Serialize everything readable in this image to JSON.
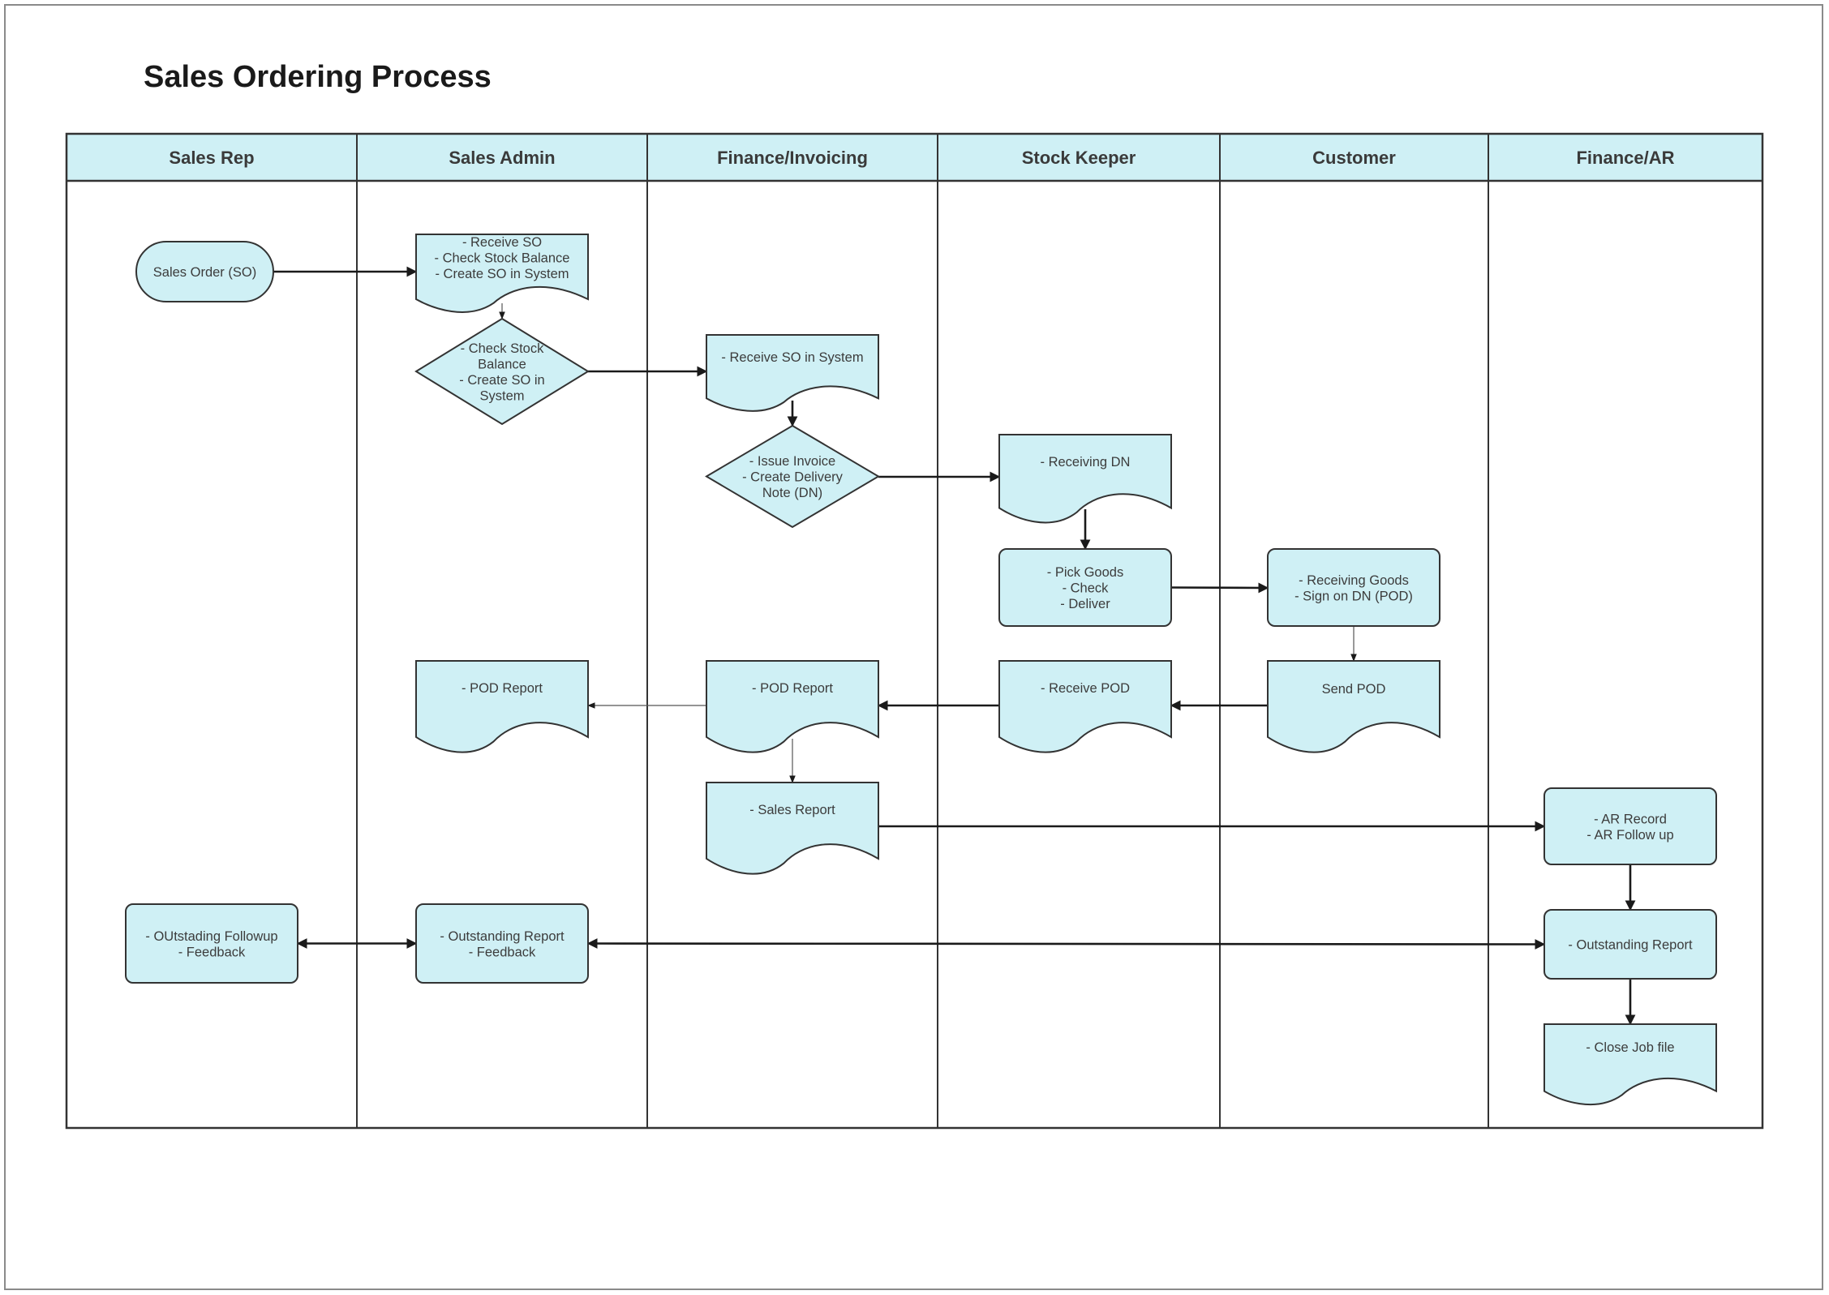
{
  "title": "Sales Ordering Process",
  "colors": {
    "shape_fill": "#cff0f5",
    "header_fill": "#cff0f5",
    "stroke": "#333333",
    "connector": "#1a1a1a"
  },
  "lanes": [
    {
      "id": "sales-rep",
      "label": "Sales Rep"
    },
    {
      "id": "sales-admin",
      "label": "Sales Admin"
    },
    {
      "id": "finance-invoicing",
      "label": "Finance/Invoicing"
    },
    {
      "id": "stock-keeper",
      "label": "Stock Keeper"
    },
    {
      "id": "customer",
      "label": "Customer"
    },
    {
      "id": "finance-ar",
      "label": "Finance/AR"
    }
  ],
  "nodes": [
    {
      "id": "n1",
      "lane": "sales-rep",
      "shape": "terminal",
      "lines": [
        "Sales Order (SO)"
      ]
    },
    {
      "id": "n2",
      "lane": "sales-admin",
      "shape": "document",
      "lines": [
        "- Receive SO",
        "- Check Stock Balance",
        "- Create SO in System"
      ]
    },
    {
      "id": "n3",
      "lane": "sales-admin",
      "shape": "decision",
      "lines": [
        "- Check Stock",
        "Balance",
        "- Create SO in",
        "System"
      ]
    },
    {
      "id": "n4",
      "lane": "finance-invoicing",
      "shape": "document",
      "lines": [
        "- Receive SO in System"
      ]
    },
    {
      "id": "n5",
      "lane": "finance-invoicing",
      "shape": "decision",
      "lines": [
        "- Issue Invoice",
        "- Create Delivery",
        "Note (DN)"
      ]
    },
    {
      "id": "n6",
      "lane": "stock-keeper",
      "shape": "document",
      "lines": [
        "- Receiving DN"
      ]
    },
    {
      "id": "n7",
      "lane": "stock-keeper",
      "shape": "process",
      "lines": [
        "- Pick Goods",
        "- Check",
        "- Deliver"
      ]
    },
    {
      "id": "n8",
      "lane": "customer",
      "shape": "process",
      "lines": [
        "- Receiving Goods",
        "- Sign on DN (POD)"
      ]
    },
    {
      "id": "n9",
      "lane": "customer",
      "shape": "document",
      "lines": [
        "Send POD"
      ]
    },
    {
      "id": "n10",
      "lane": "stock-keeper",
      "shape": "document",
      "lines": [
        "- Receive POD"
      ]
    },
    {
      "id": "n11",
      "lane": "finance-invoicing",
      "shape": "document",
      "lines": [
        "- POD Report"
      ]
    },
    {
      "id": "n12",
      "lane": "sales-admin",
      "shape": "document",
      "lines": [
        "- POD Report"
      ]
    },
    {
      "id": "n13",
      "lane": "finance-invoicing",
      "shape": "document",
      "lines": [
        "- Sales Report"
      ]
    },
    {
      "id": "n14",
      "lane": "finance-ar",
      "shape": "process",
      "lines": [
        "- AR Record",
        "- AR Follow up"
      ]
    },
    {
      "id": "n15",
      "lane": "finance-ar",
      "shape": "process",
      "lines": [
        "- Outstanding Report"
      ]
    },
    {
      "id": "n16",
      "lane": "finance-ar",
      "shape": "document",
      "lines": [
        "- Close Job file"
      ]
    },
    {
      "id": "n17",
      "lane": "sales-rep",
      "shape": "process",
      "lines": [
        "- OUtstading Followup",
        "- Feedback"
      ]
    },
    {
      "id": "n18",
      "lane": "sales-admin",
      "shape": "process",
      "lines": [
        "- Outstanding Report",
        "- Feedback"
      ]
    }
  ],
  "edges": [
    {
      "from": "n1",
      "to": "n2",
      "style": "bold"
    },
    {
      "from": "n2",
      "to": "n3",
      "style": "thin"
    },
    {
      "from": "n3",
      "to": "n4",
      "style": "bold"
    },
    {
      "from": "n4",
      "to": "n5",
      "style": "bold"
    },
    {
      "from": "n5",
      "to": "n6",
      "style": "bold"
    },
    {
      "from": "n6",
      "to": "n7",
      "style": "bold"
    },
    {
      "from": "n7",
      "to": "n8",
      "style": "bold"
    },
    {
      "from": "n8",
      "to": "n9",
      "style": "thin"
    },
    {
      "from": "n9",
      "to": "n10",
      "style": "bold"
    },
    {
      "from": "n10",
      "to": "n11",
      "style": "bold"
    },
    {
      "from": "n11",
      "to": "n12",
      "style": "thin"
    },
    {
      "from": "n11",
      "to": "n13",
      "style": "thin"
    },
    {
      "from": "n13",
      "to": "n14",
      "style": "bold"
    },
    {
      "from": "n14",
      "to": "n15",
      "style": "bold"
    },
    {
      "from": "n15",
      "to": "n16",
      "style": "bold"
    },
    {
      "from": "n17",
      "to": "n18",
      "style": "bold",
      "bidirectional": true
    },
    {
      "from": "n18",
      "to": "n15",
      "style": "bold",
      "bidirectional": true
    }
  ]
}
